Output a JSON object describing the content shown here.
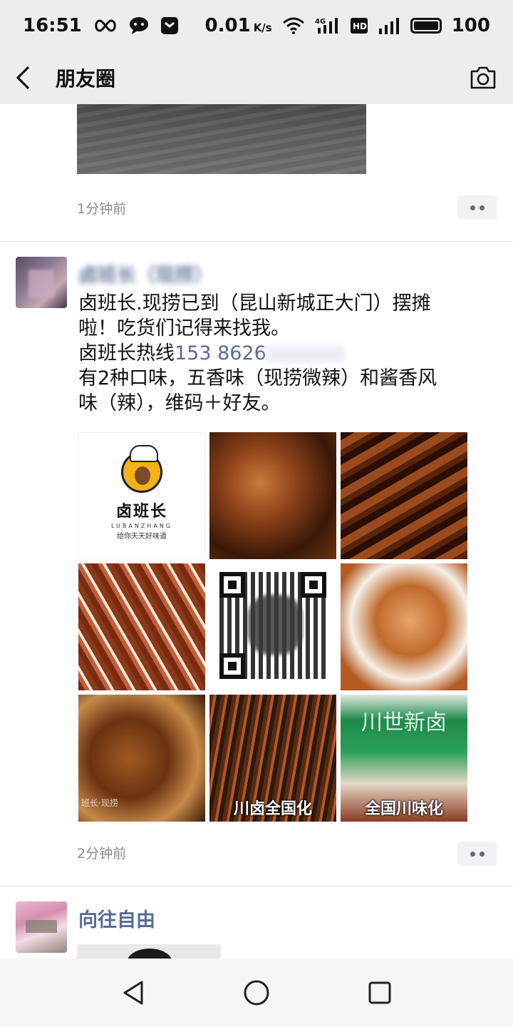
{
  "status_bar": {
    "time": "16:51",
    "speed_value": "0.01",
    "speed_unit": "K/s",
    "network": "4G",
    "hd": "HD",
    "battery": "100"
  },
  "nav": {
    "title": "朋友圈"
  },
  "post_prev": {
    "time": "1分钟前"
  },
  "post_main": {
    "nickname": "卤班长（现捞）",
    "text_lines": [
      "卤班长.现捞已到（昆山新城正大门）摆摊",
      "啦！吃货们记得来找我。",
      "卤班长热线",
      "有2种口味，五香味（现捞微辣）和酱香风",
      "味（辣），维码＋好友。"
    ],
    "phone": "153 8626",
    "images": [
      {
        "type": "logo",
        "name": "卤班长",
        "pinyin": "LUBANZHANG",
        "slogan": "给你天天好味道"
      },
      {
        "type": "food",
        "caption": ""
      },
      {
        "type": "food",
        "caption": ""
      },
      {
        "type": "food",
        "caption": ""
      },
      {
        "type": "qr",
        "caption": ""
      },
      {
        "type": "food",
        "caption": ""
      },
      {
        "type": "food",
        "caption": "班长·现捞"
      },
      {
        "type": "food",
        "caption": "川卤全国化",
        "watermark": "川世新卤"
      },
      {
        "type": "food",
        "caption": "全国川味化"
      }
    ],
    "time": "2分钟前"
  },
  "post_next": {
    "nickname": "向往自由"
  }
}
